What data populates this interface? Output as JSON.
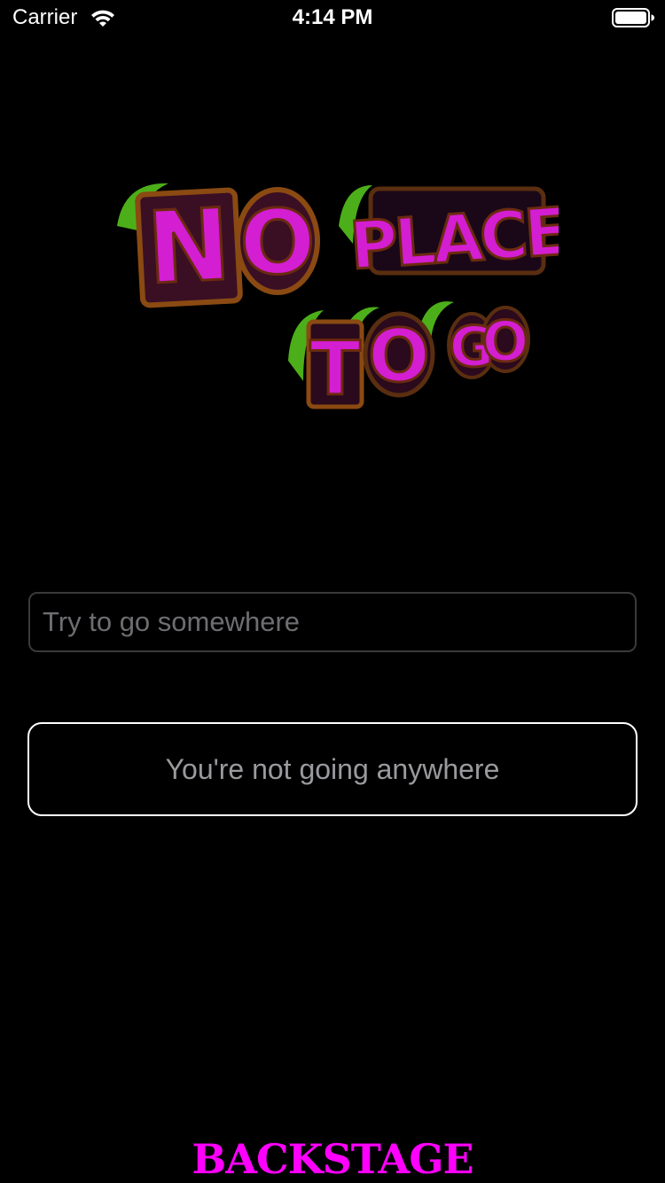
{
  "status_bar": {
    "carrier": "Carrier",
    "time": "4:14 PM",
    "wifi_icon": "wifi-icon",
    "battery_icon": "battery-icon"
  },
  "logo": {
    "line1": "NO PLACE",
    "line2": "TO GO",
    "letter_color": "#d41ed2",
    "accent_color": "#4caf1a",
    "outline_color": "#8a4a12"
  },
  "search": {
    "placeholder": "Try to go somewhere",
    "value": ""
  },
  "button": {
    "label": "You're not going anywhere"
  },
  "footer": {
    "brand": "BACKSTAGE",
    "brand_color": "#ff00ff"
  }
}
